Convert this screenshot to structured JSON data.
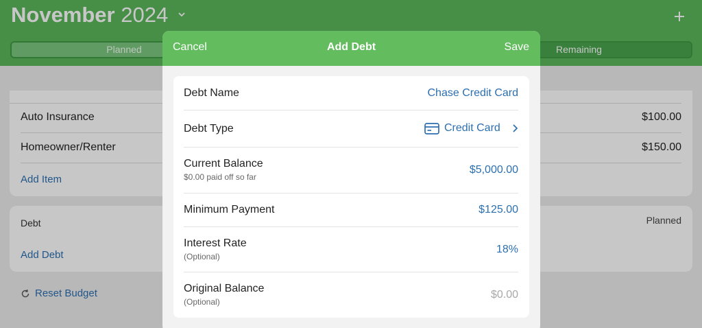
{
  "header": {
    "month": "November",
    "year": "2024",
    "tabs": {
      "planned": "Planned",
      "remaining": "Remaining"
    }
  },
  "budget": {
    "items": [
      {
        "label": "Auto Insurance",
        "amount": "$100.00"
      },
      {
        "label": "Homeowner/Renter",
        "amount": "$150.00"
      }
    ],
    "add_item": "Add Item",
    "debt_section": {
      "title": "Debt",
      "column": "Planned",
      "add_debt": "Add Debt"
    },
    "reset": "Reset Budget"
  },
  "modal": {
    "cancel": "Cancel",
    "title": "Add Debt",
    "save": "Save",
    "fields": {
      "name": {
        "label": "Debt Name",
        "value": "Chase Credit Card"
      },
      "type": {
        "label": "Debt Type",
        "value": "Credit Card"
      },
      "balance": {
        "label": "Current Balance",
        "sub": "$0.00 paid off so far",
        "value": "$5,000.00"
      },
      "min_payment": {
        "label": "Minimum Payment",
        "value": "$125.00"
      },
      "interest": {
        "label": "Interest Rate",
        "sub": "(Optional)",
        "value": "18%"
      },
      "original": {
        "label": "Original Balance",
        "sub": "(Optional)",
        "value": "$0.00"
      }
    }
  },
  "colors": {
    "header_green": "#5cb85c",
    "link_blue": "#2c6fb0"
  },
  "icons": [
    "chevron-down-icon",
    "plus-icon",
    "refresh-icon",
    "credit-card-icon",
    "chevron-right-icon"
  ]
}
